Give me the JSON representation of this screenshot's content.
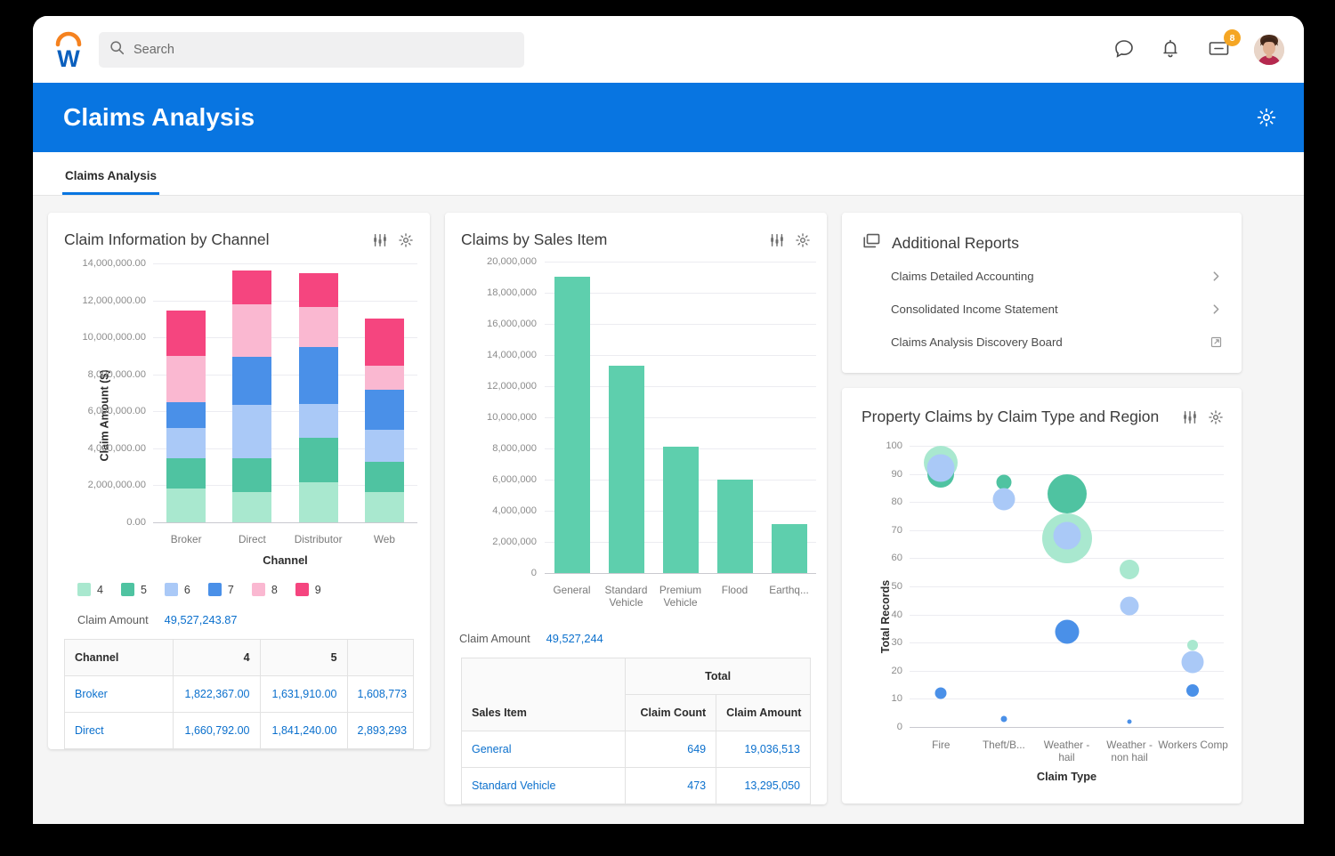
{
  "topbar": {
    "logo_icon": "workday-logo",
    "search_placeholder": "Search",
    "search_value": "",
    "icons": [
      {
        "name": "chat-icon",
        "label": "Chat"
      },
      {
        "name": "bell-icon",
        "label": "Notifications"
      },
      {
        "name": "inbox-icon",
        "label": "Inbox",
        "badge": "8"
      },
      {
        "name": "avatar",
        "label": "Profile"
      }
    ]
  },
  "banner": {
    "title": "Claims Analysis",
    "gear_icon": "gear-icon"
  },
  "tabs": [
    {
      "label": "Claims Analysis",
      "active": true
    }
  ],
  "colors": {
    "brand_blue": "#0875e1",
    "link_blue": "#0b70cd",
    "series": [
      "#a9e8cf",
      "#4fc3a1",
      "#aac9f7",
      "#4a90e8",
      "#fab8d1",
      "#f5457f"
    ],
    "bubble_mint": "#a9e8cf",
    "bubble_green": "#4fc3a1",
    "bubble_lightblue": "#aac9f7",
    "bubble_blue": "#4a90e8"
  },
  "card1": {
    "title": "Claim Information by Channel",
    "filter_icon": "filter-sliders-icon",
    "gear_icon": "gear-icon",
    "total_label": "Claim Amount",
    "total_value": "49,527,243.87",
    "legend": [
      {
        "label": "4",
        "color": "#a9e8cf"
      },
      {
        "label": "5",
        "color": "#4fc3a1"
      },
      {
        "label": "6",
        "color": "#aac9f7"
      },
      {
        "label": "7",
        "color": "#4a90e8"
      },
      {
        "label": "8",
        "color": "#fab8d1"
      },
      {
        "label": "9",
        "color": "#f5457f"
      }
    ],
    "table": {
      "headers": [
        "Channel",
        "4",
        "5",
        ""
      ],
      "rows": [
        {
          "channel": "Broker",
          "c4": "1,822,367.00",
          "c5": "1,631,910.00",
          "c6": "1,608,773"
        },
        {
          "channel": "Direct",
          "c4": "1,660,792.00",
          "c5": "1,841,240.00",
          "c6": "2,893,293"
        }
      ]
    }
  },
  "card2": {
    "title": "Claims by Sales Item",
    "filter_icon": "filter-sliders-icon",
    "gear_icon": "gear-icon",
    "total_label": "Claim Amount",
    "total_value": "49,527,244",
    "table": {
      "group_header": "Total",
      "headers": [
        "Sales Item",
        "Claim Count",
        "Claim Amount"
      ],
      "rows": [
        {
          "item": "General",
          "count": "649",
          "amount": "19,036,513"
        },
        {
          "item": "Standard Vehicle",
          "count": "473",
          "amount": "13,295,050"
        }
      ]
    }
  },
  "card3": {
    "title": "Additional Reports",
    "panel_icon": "reports-stack-icon",
    "items": [
      {
        "label": "Claims Detailed Accounting",
        "icon": "chevron-right-icon"
      },
      {
        "label": "Consolidated Income Statement",
        "icon": "chevron-right-icon"
      },
      {
        "label": "Claims Analysis Discovery Board",
        "icon": "external-link-icon"
      }
    ]
  },
  "card4": {
    "title": "Property Claims by Claim Type and Region",
    "filter_icon": "filter-sliders-icon",
    "gear_icon": "gear-icon"
  },
  "chart_data": [
    {
      "type": "bar",
      "stacked": true,
      "title": "Claim Information by Channel",
      "xlabel": "Channel",
      "ylabel": "Claim Amount ($)",
      "categories": [
        "Broker",
        "Direct",
        "Distributor",
        "Web"
      ],
      "ylim": [
        0,
        14000000
      ],
      "ytick_labels": [
        "0.00",
        "2,000,000.00",
        "4,000,000.00",
        "6,000,000.00",
        "8,000,000.00",
        "10,000,000.00",
        "12,000,000.00",
        "14,000,000.00"
      ],
      "yticks": [
        0,
        2000000,
        4000000,
        6000000,
        8000000,
        10000000,
        12000000,
        14000000
      ],
      "grid": true,
      "legend_position": "bottom",
      "series": [
        {
          "name": "4",
          "color": "#a9e8cf",
          "values": [
            1822367,
            1631910,
            2170000,
            1620000
          ]
        },
        {
          "name": "5",
          "color": "#4fc3a1",
          "values": [
            1660792,
            1841240,
            2400000,
            1670000
          ]
        },
        {
          "name": "6",
          "color": "#aac9f7",
          "values": [
            1608773,
            2893293,
            1850000,
            1700000
          ]
        },
        {
          "name": "7",
          "color": "#4a90e8",
          "values": [
            1380000,
            2580000,
            3080000,
            2200000
          ]
        },
        {
          "name": "8",
          "color": "#fab8d1",
          "values": [
            2520000,
            2850000,
            2150000,
            1300000
          ]
        },
        {
          "name": "9",
          "color": "#f5457f",
          "values": [
            2480000,
            1800000,
            1820000,
            2550000
          ]
        }
      ]
    },
    {
      "type": "bar",
      "stacked": false,
      "title": "Claims by Sales Item",
      "xlabel": "",
      "ylabel": "",
      "categories": [
        "General",
        "Standard Vehicle",
        "Premium Vehicle",
        "Flood",
        "Earthq..."
      ],
      "values": [
        19036513,
        13295050,
        8100000,
        6000000,
        3120000
      ],
      "color": "#5ecfad",
      "ylim": [
        0,
        20000000
      ],
      "yticks": [
        0,
        2000000,
        4000000,
        6000000,
        8000000,
        10000000,
        12000000,
        14000000,
        16000000,
        18000000,
        20000000
      ],
      "ytick_labels": [
        "0",
        "2,000,000",
        "4,000,000",
        "6,000,000",
        "8,000,000",
        "10,000,000",
        "12,000,000",
        "14,000,000",
        "16,000,000",
        "18,000,000",
        "20,000,000"
      ],
      "grid": true
    },
    {
      "type": "scatter",
      "bubble": true,
      "title": "Property Claims by Claim Type and Region",
      "xlabel": "Claim Type",
      "ylabel": "Total Records",
      "categories": [
        "Fire",
        "Theft/B...",
        "Weather - hail",
        "Weather - non hail",
        "Workers Comp"
      ],
      "ylim": [
        0,
        100
      ],
      "yticks": [
        0,
        10,
        20,
        30,
        40,
        50,
        60,
        70,
        80,
        90,
        100
      ],
      "ytick_labels": [
        "0",
        "10",
        "20",
        "30",
        "40",
        "50",
        "60",
        "70",
        "80",
        "90",
        "100"
      ],
      "grid": true,
      "points": [
        {
          "x": "Fire",
          "y": 94,
          "size": 38,
          "color": "#a9e8cf"
        },
        {
          "x": "Fire",
          "y": 90,
          "size": 30,
          "color": "#4fc3a1"
        },
        {
          "x": "Fire",
          "y": 92,
          "size": 31,
          "color": "#aac9f7"
        },
        {
          "x": "Fire",
          "y": 12,
          "size": 13,
          "color": "#4a90e8"
        },
        {
          "x": "Theft/B...",
          "y": 87,
          "size": 17,
          "color": "#4fc3a1"
        },
        {
          "x": "Theft/B...",
          "y": 81,
          "size": 25,
          "color": "#aac9f7"
        },
        {
          "x": "Theft/B...",
          "y": 3,
          "size": 7,
          "color": "#4a90e8"
        },
        {
          "x": "Weather - hail",
          "y": 83,
          "size": 44,
          "color": "#4fc3a1"
        },
        {
          "x": "Weather - hail",
          "y": 67,
          "size": 56,
          "color": "#a9e8cf"
        },
        {
          "x": "Weather - hail",
          "y": 68,
          "size": 31,
          "color": "#aac9f7"
        },
        {
          "x": "Weather - hail",
          "y": 34,
          "size": 27,
          "color": "#4a90e8"
        },
        {
          "x": "Weather - non hail",
          "y": 56,
          "size": 22,
          "color": "#a9e8cf"
        },
        {
          "x": "Weather - non hail",
          "y": 43,
          "size": 21,
          "color": "#aac9f7"
        },
        {
          "x": "Weather - non hail",
          "y": 2,
          "size": 5,
          "color": "#4a90e8"
        },
        {
          "x": "Workers Comp",
          "y": 29,
          "size": 12,
          "color": "#a9e8cf"
        },
        {
          "x": "Workers Comp",
          "y": 23,
          "size": 25,
          "color": "#aac9f7"
        },
        {
          "x": "Workers Comp",
          "y": 13,
          "size": 14,
          "color": "#4a90e8"
        }
      ]
    }
  ]
}
